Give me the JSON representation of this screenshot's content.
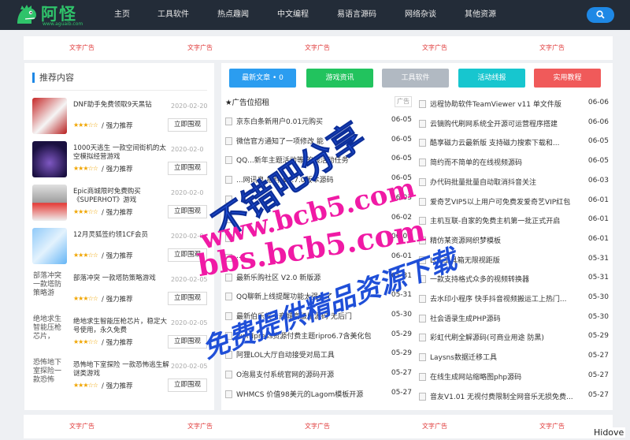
{
  "header": {
    "logo_text": "阿怪",
    "logo_sub": "www.aguaib.com",
    "nav": [
      "主页",
      "工具软件",
      "热点趣闻",
      "中文编程",
      "易语言源码",
      "网络杂谈",
      "其他资源"
    ]
  },
  "ads": {
    "label": "文字广告",
    "top_count": 5,
    "bottom_count": 5
  },
  "left": {
    "title": "推荐内容",
    "items": [
      {
        "title": "DNF助手免费领取9天黑钻",
        "date": "2020-02-20",
        "stars": "★★★☆☆",
        "tag": "/ 强力推荐",
        "btn": "立即围观",
        "thumb": ""
      },
      {
        "title": "1000天逃生 一款空间街机的太空模拟经营游戏",
        "date": "2020-02-0",
        "stars": "★★★☆☆",
        "tag": "/ 强力推荐",
        "btn": "立即围观",
        "thumb": ""
      },
      {
        "title": "Epic商城限时免费购买《SUPERHOT》游戏",
        "date": "2020-02-0",
        "stars": "★★★☆☆",
        "tag": "/ 强力推荐",
        "btn": "立即围观",
        "thumb": ""
      },
      {
        "title": "12月灵狐签约领1CF会员",
        "date": "2020-02-0",
        "stars": "★★★☆☆",
        "tag": "/ 强力推荐",
        "btn": "立即围观",
        "thumb": ""
      },
      {
        "title": "部落冲突 一款塔防策略游戏",
        "date": "2020-02-05",
        "stars": "★★★☆☆",
        "tag": "/ 强力推荐",
        "btn": "立即围观",
        "thumb": "部落冲突一款塔防策略游"
      },
      {
        "title": "绝地求生智能压枪芯片，稳定大号使用，永久免费",
        "date": "2020-02-05",
        "stars": "★★★☆☆",
        "tag": "/ 强力推荐",
        "btn": "立即围观",
        "thumb": "绝地求生智能压枪芯片，"
      },
      {
        "title": "恐怖地下室探险 一款恐怖逃生解谜类游戏",
        "date": "2020-02-05",
        "stars": "★★★☆☆",
        "tag": "/ 强力推荐",
        "btn": "立即围观",
        "thumb": "恐怖地下室探险一款恐怖"
      }
    ]
  },
  "tabs": [
    {
      "label": "最新文章 • 0",
      "color": "#2b9df0"
    },
    {
      "label": "游戏资讯",
      "color": "#22c35e"
    },
    {
      "label": "工具软件",
      "color": "#b1b9c2"
    },
    {
      "label": "活动线报",
      "color": "#17c6cf"
    },
    {
      "label": "实用教程",
      "color": "#f05a5a"
    }
  ],
  "list_head": "★广告位招租",
  "ad_tag": "广告",
  "left_list": [
    {
      "t": "京东白条新用户0.01元购买",
      "d": "06-05"
    },
    {
      "t": "微信官方通知了一项修改 能",
      "d": "06-05"
    },
    {
      "t": "QQ...新年主题活动等 的线活动任务",
      "d": "06-05"
    },
    {
      "t": "...网讯息 插件 v0.7.0版本源码",
      "d": "06-05"
    },
    {
      "t": "",
      "d": "06-03"
    },
    {
      "t": "",
      "d": "06-02"
    },
    {
      "t": "",
      "d": "06-01"
    },
    {
      "t": "...",
      "d": "06-01"
    },
    {
      "t": "最新乐购社区 V2.0 新版源",
      "d": "05-31"
    },
    {
      "t": "QQ聊新上线提醒功能太强大了",
      "d": "05-31"
    },
    {
      "t": "最新伯乐发卡商城高级版源码 无后门",
      "d": "05-30"
    },
    {
      "t": "wordpress资源付费主题ripro6.7含美化包",
      "d": "05-29"
    },
    {
      "t": "阿狸LOL大厅自动接受对局工具",
      "d": "05-29"
    },
    {
      "t": "O泡易支付系统官网的源码开源",
      "d": "05-27"
    },
    {
      "t": "WHMCS 价值98美元的Lagom模板开源",
      "d": "05-27"
    }
  ],
  "right_list": [
    {
      "t": "远程协助软件TeamViewer v11 单文件版",
      "d": "06-06"
    },
    {
      "t": "云镝购代刷网系统全开源可运营程序搭建",
      "d": "06-06"
    },
    {
      "t": "酷享磁力云最新版 支持磁力搜索下载和...",
      "d": "06-05"
    },
    {
      "t": "简约而不简单的在线视频源码",
      "d": "06-05"
    },
    {
      "t": "办代码批量批量自动取消抖音关注",
      "d": "06-03"
    },
    {
      "t": "爱奇艺VIP5以上用户可免费发爱奇艺VIP红包",
      "d": "06-01"
    },
    {
      "t": "主机互联-自家的免费主机第一批正式开启",
      "d": "06-01"
    },
    {
      "t": "精仿某资源网织梦模板",
      "d": "06-01"
    },
    {
      "t": "LOL工具箱无限视距版",
      "d": "05-31"
    },
    {
      "t": "一款支持格式众多的视频转换器",
      "d": "05-31"
    },
    {
      "t": "去水印小程序 快手抖音视频搬运工上热门...",
      "d": "05-30"
    },
    {
      "t": "社会语录生成PHP源码",
      "d": "05-30"
    },
    {
      "t": "彩虹代刷全解源码(可商业用途 防黑)",
      "d": "05-29"
    },
    {
      "t": "Laysns数据迁移工具",
      "d": "05-27"
    },
    {
      "t": "在线生成网站缩略图php源码",
      "d": "05-27"
    },
    {
      "t": "音友V1.01 无视付费限制全网音乐无损免费...",
      "d": "05-27"
    }
  ],
  "watermark": {
    "line1": "不错吧分享",
    "line2": "www.bcb5.com",
    "line3": "bbs.bcb5.com",
    "line4": "免费提供精品资源下载",
    "corner": "Hidove"
  }
}
